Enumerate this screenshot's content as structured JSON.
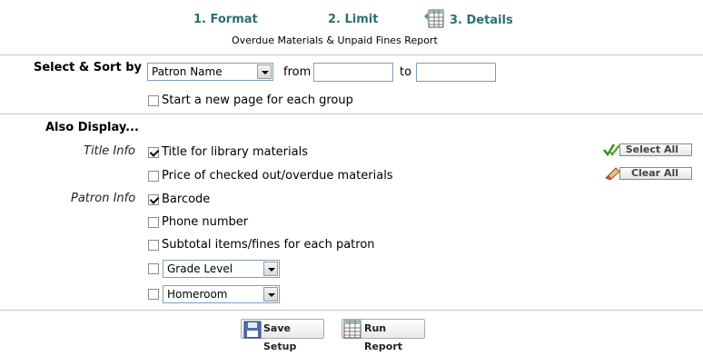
{
  "steps": {
    "format": "1. Format",
    "limit": "2. Limit",
    "details": "3. Details"
  },
  "subtitle": "Overdue Materials & Unpaid Fines Report",
  "select_sort": {
    "label": "Select & Sort by",
    "dropdown_value": "Patron Name",
    "from_label": "from",
    "to_label": "to",
    "from_value": "",
    "to_value": "",
    "new_page_label": "Start a new page for each group",
    "new_page_checked": false
  },
  "also_display": {
    "heading": "Also Display...",
    "title_info_label": "Title Info",
    "patron_info_label": "Patron Info",
    "options": {
      "title_for_materials": {
        "label": "Title for library materials",
        "checked": true
      },
      "price": {
        "label": "Price of checked out/overdue materials",
        "checked": false
      },
      "barcode": {
        "label": "Barcode",
        "checked": true
      },
      "phone": {
        "label": "Phone number",
        "checked": false
      },
      "subtotal": {
        "label": "Subtotal items/fines for each patron",
        "checked": false
      },
      "grade_level": {
        "value": "Grade Level",
        "checked": false
      },
      "homeroom": {
        "value": "Homeroom",
        "checked": false
      }
    },
    "select_all": "Select All",
    "clear_all": "Clear All"
  },
  "footer": {
    "save_setup": "Save Setup",
    "run_report": "Run Report"
  },
  "colors": {
    "step_text": "#2b6f6f",
    "divider": "#c8c8c8"
  }
}
